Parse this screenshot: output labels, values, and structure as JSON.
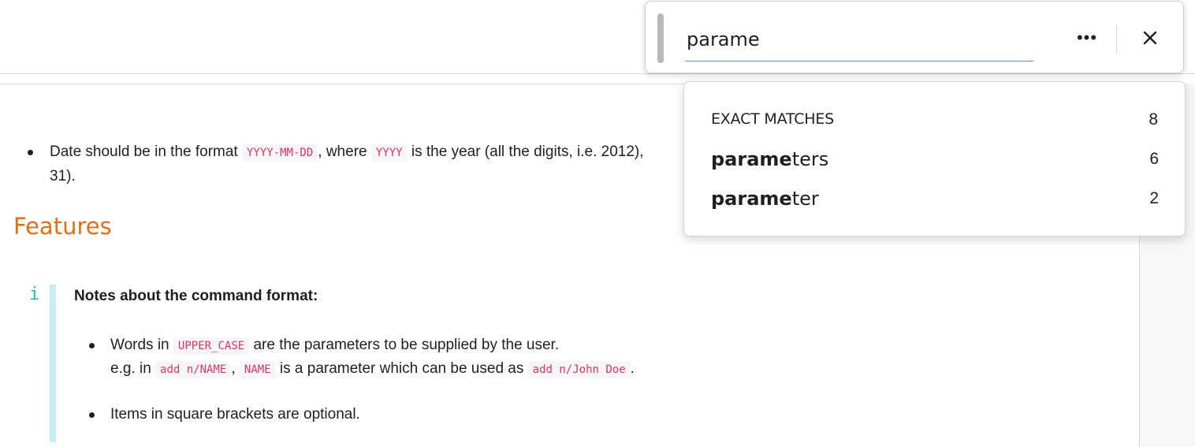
{
  "find": {
    "query": "parame",
    "more_label": "•••",
    "close_label": "✕"
  },
  "suggestions": {
    "header": "EXACT MATCHES",
    "header_count": "8",
    "items": [
      {
        "match": "parame",
        "rest": "ters",
        "count": "6"
      },
      {
        "match": "parame",
        "rest": "ter",
        "count": "2"
      }
    ]
  },
  "doc": {
    "date_bullet": {
      "t1": "Date should be in the format",
      "code1": "YYYY-MM-DD",
      "t2": ", where",
      "code2": "YYYY",
      "t3": "is the year (all the digits, i.e. 2012),",
      "t4": "31)."
    },
    "heading": "Features",
    "info_icon": "i",
    "callout_title": "Notes about the command format:",
    "bullet1": {
      "t1": "Words in",
      "code1": "UPPER_CASE",
      "t2": "are the parameters to be supplied by the user.",
      "t3": "e.g. in",
      "code2": "add n/NAME",
      "t4": ",",
      "code3": "NAME",
      "t5": "is a parameter which can be used as",
      "code4": "add n/John Doe",
      "t6": "."
    },
    "bullet2": {
      "t1": "Items in square brackets are optional."
    }
  },
  "colors": {
    "heading": "#e07016",
    "code_text": "#d6336c",
    "info_accent": "#1fb2d8",
    "callout_bar": "#c9ecfb",
    "find_underline": "#6a8fd0"
  }
}
